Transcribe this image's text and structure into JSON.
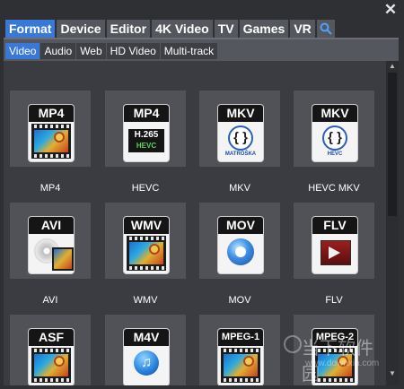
{
  "category_tabs": [
    {
      "label": "Format",
      "active": true
    },
    {
      "label": "Device",
      "active": false
    },
    {
      "label": "Editor",
      "active": false
    },
    {
      "label": "4K Video",
      "active": false
    },
    {
      "label": "TV",
      "active": false
    },
    {
      "label": "Games",
      "active": false
    },
    {
      "label": "VR",
      "active": false
    }
  ],
  "close_symbol": "✕",
  "sub_tabs": [
    {
      "label": "Video",
      "active": true
    },
    {
      "label": "Audio",
      "active": false
    },
    {
      "label": "Web",
      "active": false
    },
    {
      "label": "HD Video",
      "active": false
    },
    {
      "label": "Multi-track",
      "active": false
    }
  ],
  "formats": [
    {
      "label": "MP4",
      "badge": "MP4",
      "icon": "film-reel-icon"
    },
    {
      "label": "HEVC",
      "badge": "MP4",
      "icon": "h265-hevc-icon",
      "inner_text": "H.265",
      "inner_sub": "HEVC"
    },
    {
      "label": "MKV",
      "badge": "MKV",
      "icon": "matroska-icon",
      "inner_sub": "MATROŠKA"
    },
    {
      "label": "HEVC MKV",
      "badge": "MKV",
      "icon": "matroska-hevc-icon",
      "inner_sub": "HEVC"
    },
    {
      "label": "AVI",
      "badge": "AVI",
      "icon": "disc-film-icon"
    },
    {
      "label": "WMV",
      "badge": "WMV",
      "icon": "film-reel-icon"
    },
    {
      "label": "MOV",
      "badge": "MOV",
      "icon": "quicktime-icon"
    },
    {
      "label": "FLV",
      "badge": "FLV",
      "icon": "flash-video-icon"
    },
    {
      "label": "",
      "badge": "ASF",
      "icon": "film-reel-icon"
    },
    {
      "label": "",
      "badge": "M4V",
      "icon": "itunes-icon"
    },
    {
      "label": "",
      "badge": "MPEG-1",
      "icon": "film-reel-icon"
    },
    {
      "label": "",
      "badge": "MPEG-2",
      "icon": "film-reel-icon"
    }
  ],
  "watermark": {
    "main": "当下软件园",
    "sub": "www.downxia.com"
  },
  "colors": {
    "accent": "#3a78d8",
    "tab_bg": "#54575d",
    "panel_bg": "#3a3c41",
    "tile_bg": "#505258"
  }
}
